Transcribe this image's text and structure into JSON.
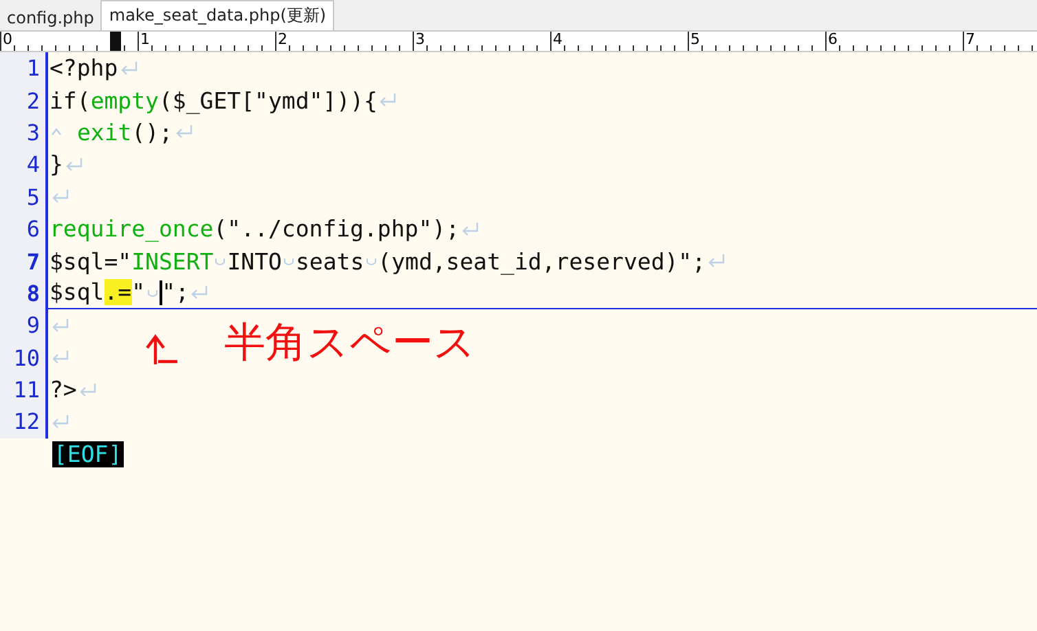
{
  "tabs": [
    {
      "label": "config.php",
      "selected": false
    },
    {
      "label": "make_seat_data.php(更新)",
      "selected": true
    }
  ],
  "ruler": {
    "labels": [
      "0",
      "1",
      "2",
      "3",
      "4",
      "5",
      "6",
      "7"
    ]
  },
  "lines": [
    {
      "number": "1",
      "modified": false,
      "current": false,
      "tokens": [
        {
          "kind": "plain",
          "text": "<?php"
        }
      ]
    },
    {
      "number": "2",
      "modified": false,
      "current": false,
      "tokens": [
        {
          "kind": "plain",
          "text": "if("
        },
        {
          "kind": "keyword",
          "text": "empty"
        },
        {
          "kind": "plain",
          "text": "($_GET[\"ymd\"])){"
        }
      ]
    },
    {
      "number": "3",
      "modified": false,
      "current": false,
      "tokens": [
        {
          "kind": "tab"
        },
        {
          "kind": "keyword",
          "text": "exit"
        },
        {
          "kind": "plain",
          "text": "();"
        }
      ]
    },
    {
      "number": "4",
      "modified": false,
      "current": false,
      "tokens": [
        {
          "kind": "plain",
          "text": "}"
        }
      ]
    },
    {
      "number": "5",
      "modified": false,
      "current": false
    },
    {
      "number": "6",
      "modified": false,
      "current": false,
      "tokens": [
        {
          "kind": "keyword",
          "text": "require_once"
        },
        {
          "kind": "plain",
          "text": "(\"../config.php\");"
        }
      ]
    },
    {
      "number": "7",
      "modified": true,
      "current": false,
      "tokens": [
        {
          "kind": "plain",
          "text": "$sql=\""
        },
        {
          "kind": "keyword",
          "text": "INSERT"
        },
        {
          "kind": "space"
        },
        {
          "kind": "plain",
          "text": "INTO"
        },
        {
          "kind": "space"
        },
        {
          "kind": "plain",
          "text": "seats"
        },
        {
          "kind": "space"
        },
        {
          "kind": "plain",
          "text": "(ymd,seat_id,reserved)\";"
        }
      ]
    },
    {
      "number": "8",
      "modified": true,
      "current": true,
      "tokens": [
        {
          "kind": "plain",
          "text": "$sql"
        },
        {
          "kind": "highlight",
          "text": ".="
        },
        {
          "kind": "plain",
          "text": "\""
        },
        {
          "kind": "space"
        },
        {
          "kind": "cursor"
        },
        {
          "kind": "plain",
          "text": "\";"
        }
      ]
    },
    {
      "number": "9",
      "modified": false,
      "current": false
    },
    {
      "number": "10",
      "modified": false,
      "current": false
    },
    {
      "number": "11",
      "modified": false,
      "current": false,
      "tokens": [
        {
          "kind": "plain",
          "text": "?>"
        }
      ]
    },
    {
      "number": "12",
      "modified": false,
      "current": false
    }
  ],
  "eof_marker": "[EOF]",
  "annotation": {
    "text": "半角スペース"
  }
}
